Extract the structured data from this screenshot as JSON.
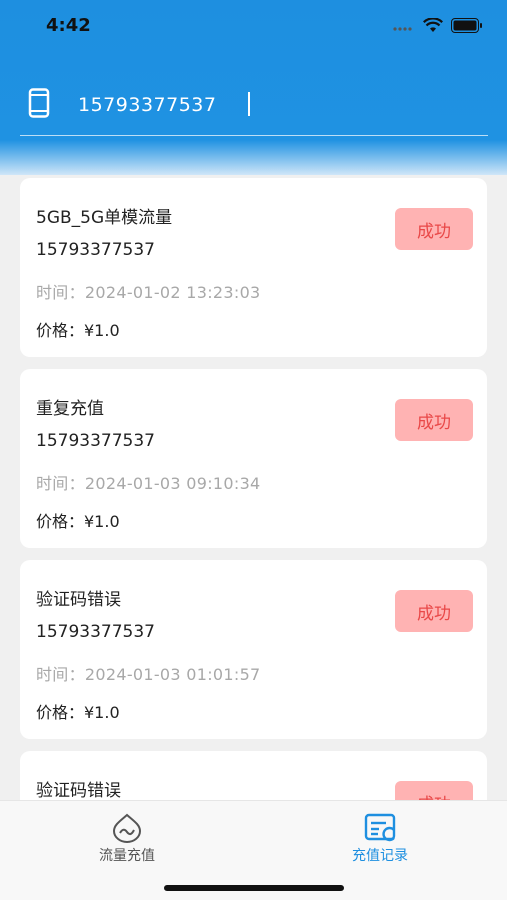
{
  "status_bar": {
    "time": "4:42"
  },
  "phone_field": {
    "value": "15793377537"
  },
  "records": [
    {
      "title": "5GB_5G单模流量",
      "phone": "15793377537",
      "time": "时间：2024-01-02 13:23:03",
      "price": "价格：¥1.0",
      "status": "成功"
    },
    {
      "title": "重复充值",
      "phone": "15793377537",
      "time": "时间：2024-01-03 09:10:34",
      "price": "价格：¥1.0",
      "status": "成功"
    },
    {
      "title": "验证码错误",
      "phone": "15793377537",
      "time": "时间：2024-01-03 01:01:57",
      "price": "价格：¥1.0",
      "status": "成功"
    },
    {
      "title": "验证码错误",
      "status": "成功"
    }
  ],
  "tabbar": {
    "tabs": [
      {
        "label": "流量充值",
        "icon": "data-topup-icon",
        "active": false
      },
      {
        "label": "充值记录",
        "icon": "recharge-record-icon",
        "active": true
      }
    ]
  },
  "colors": {
    "header": "#1f92e2",
    "success_bg": "#ffb3b3",
    "success_text": "#e94848",
    "active_tab": "#1e8fe0",
    "inactive_tab": "#555555"
  }
}
